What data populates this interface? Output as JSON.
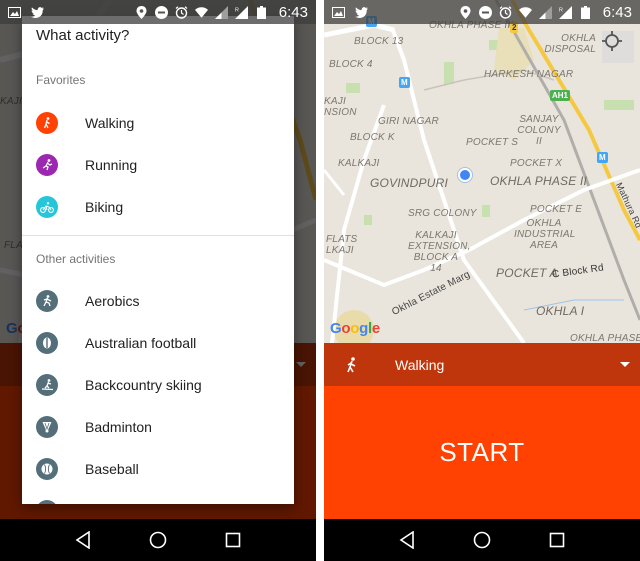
{
  "status_bar": {
    "time": "6:43",
    "left_icons": [
      "image-icon",
      "twitter-icon"
    ],
    "right_icons": [
      "location-icon",
      "do-not-disturb-icon",
      "alarm-icon",
      "wifi-icon",
      "signal-icon",
      "signal-roaming-icon",
      "battery-icon"
    ],
    "roaming_label": "R"
  },
  "colors": {
    "walking": "#ff4102",
    "running": "#9c27b0",
    "biking": "#26c6da",
    "other": "#546e7a",
    "activity_bar": "#bf360c",
    "start": "#ff4102"
  },
  "dialog": {
    "title": "What activity?",
    "favorites_header": "Favorites",
    "favorites": [
      {
        "label": "Walking",
        "icon": "walking-icon"
      },
      {
        "label": "Running",
        "icon": "running-icon"
      },
      {
        "label": "Biking",
        "icon": "biking-icon"
      }
    ],
    "other_header": "Other activities",
    "other": [
      {
        "label": "Aerobics",
        "icon": "aerobics-icon"
      },
      {
        "label": "Australian football",
        "icon": "australian-football-icon"
      },
      {
        "label": "Backcountry skiing",
        "icon": "backcountry-skiing-icon"
      },
      {
        "label": "Badminton",
        "icon": "badminton-icon"
      },
      {
        "label": "Baseball",
        "icon": "baseball-icon"
      }
    ]
  },
  "map": {
    "labels": {
      "okhla_phase_iii": "OKHLA PHASE III",
      "block_13": "BLOCK 13",
      "block_4": "BLOCK 4",
      "kalkaji_extension_top": "KAJI NSION",
      "harkesh_nagar": "HARKESH NAGAR",
      "okhla_disposal": "OKHLA DISPOSAL",
      "giri_nagar": "GIRI NAGAR",
      "sanjay_colony": "SANJAY COLONY II",
      "block_k": "BLOCK K",
      "pocket_s": "POCKET S",
      "kalkaji": "KALKAJI",
      "pocket_x": "POCKET X",
      "govindpuri": "GOVINDPURI",
      "okhla_phase_ii": "OKHLA PHASE II",
      "srg_colony": "SRG COLONY",
      "pocket_e": "POCKET E",
      "okhla_industrial": "OKHLA INDUSTRIAL AREA",
      "kalkaji_extension": "KALKAJI EXTENSION, BLOCK A 14",
      "flats_kalkaji": "FLATS LKAJI",
      "pocket_a": "POCKET A",
      "c_block_rd": "C Block Rd",
      "okhla_estate_marg": "Okhla Estate Marg",
      "okhla_i": "OKHLA I",
      "okhla_phase": "OKHLA PHASE",
      "mathura_rd": "Mathura Rd",
      "badge_2": "2",
      "badge_ah1": "AH1",
      "metro": "M"
    },
    "google_logo": [
      "G",
      "o",
      "o",
      "g",
      "l",
      "e"
    ]
  },
  "activity_selector": {
    "selected": "Walking",
    "icon": "walking-icon"
  },
  "start_button": "START",
  "nav": [
    "back-button",
    "home-button",
    "recents-button"
  ]
}
